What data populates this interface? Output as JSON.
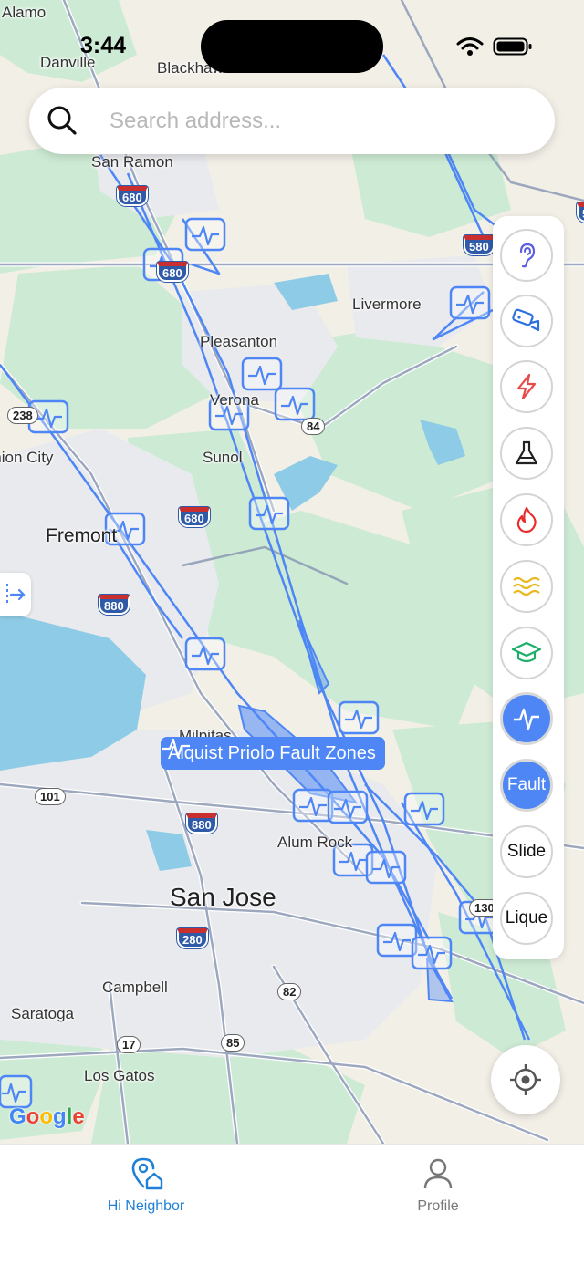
{
  "status_bar": {
    "time": "3:44"
  },
  "search": {
    "placeholder": "Search address..."
  },
  "map": {
    "places": [
      "Alamo",
      "Danville",
      "Blackhawk",
      "San Ramon",
      "Livermore",
      "Pleasanton",
      "Verona",
      "Sunol",
      "Fremont",
      "Union City",
      "Milpitas",
      "Alum Rock",
      "San Jose",
      "Campbell",
      "Saratoga",
      "Los Gatos"
    ],
    "highways": [
      "680",
      "680",
      "580",
      "580",
      "238",
      "84",
      "680",
      "880",
      "101",
      "880",
      "280",
      "82",
      "17",
      "85",
      "130"
    ],
    "fault_zone_label": "Alquist Priolo Fault Zones",
    "attribution": "Google",
    "colors": {
      "fault_line": "#4e87f5",
      "accent": "#4e87f5"
    }
  },
  "layers": {
    "icons": [
      "ear-icon",
      "camera-icon",
      "lightning-icon",
      "flask-icon",
      "fire-icon",
      "water-waves-icon",
      "graduation-cap-icon",
      "seismic-wave-icon"
    ],
    "active_icon": "seismic-wave-icon",
    "fault": "Fault",
    "slide": "Slide",
    "lique": "Lique"
  },
  "tabs": {
    "hi_neighbor": "Hi Neighbor",
    "profile": "Profile"
  }
}
